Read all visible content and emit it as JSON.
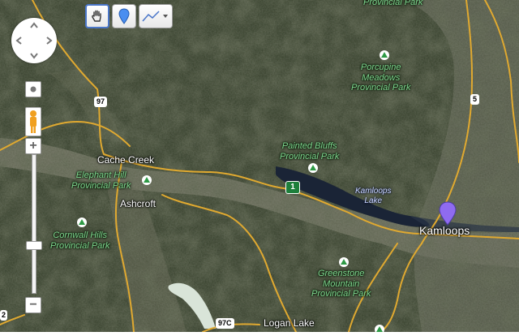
{
  "map": {
    "type": "satellite",
    "colors": {
      "terrain_dark": "#26301f",
      "terrain_mid": "#3c4530",
      "valley": "#6b6e5c",
      "lake": "#1a2436",
      "road": "#e0a930",
      "park_label": "#7fd68f"
    },
    "places": {
      "kamloops": "Kamloops",
      "cache_creek": "Cache Creek",
      "ashcroft": "Ashcroft",
      "logan_lake": "Logan Lake",
      "kamloops_lake": "Kamloops\nLake"
    },
    "parks": {
      "top_park": "Provincial Park",
      "porcupine": "Porcupine\nMeadows\nProvincial Park",
      "painted_bluffs": "Painted Bluffs\nProvincial Park",
      "elephant_hill": "Elephant Hill\nProvincial Park",
      "cornwall_hills": "Cornwall Hills\nProvincial Park",
      "greenstone": "Greenstone\nMountain\nProvincial Park"
    },
    "routes": {
      "hwy97": "97",
      "hwy5": "5",
      "hwy97c": "97C",
      "trans_canada": "1",
      "edge_marker": "2"
    },
    "marker": {
      "name": "kamloops-pin",
      "color": "#8f6bf0"
    }
  },
  "controls": {
    "tools": [
      "hand-tool",
      "marker-tool",
      "line-tool"
    ],
    "zoom_in": "+",
    "zoom_out": "−",
    "zoom_level": 0.66
  }
}
